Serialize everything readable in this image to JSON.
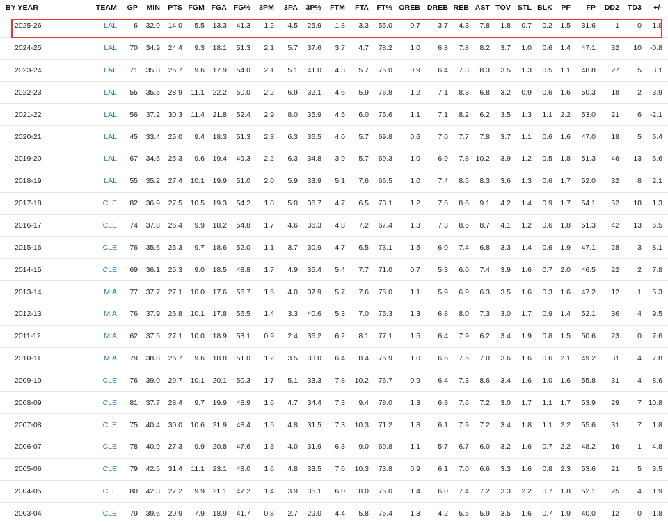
{
  "table": {
    "columns": [
      "BY YEAR",
      "TEAM",
      "GP",
      "MIN",
      "PTS",
      "FGM",
      "FGA",
      "FG%",
      "3PM",
      "3PA",
      "3P%",
      "FTM",
      "FTA",
      "FT%",
      "OREB",
      "DREB",
      "REB",
      "AST",
      "TOV",
      "STL",
      "BLK",
      "PF",
      "FP",
      "DD2",
      "TD3",
      "+/-"
    ],
    "highlighted_row": 0,
    "highlight_color": "#e53935",
    "team_link_color": "#1d72c2",
    "rows": [
      [
        "2025-26",
        "LAL",
        "6",
        "32.9",
        "14.0",
        "5.5",
        "13.3",
        "41.3",
        "1.2",
        "4.5",
        "25.9",
        "1.8",
        "3.3",
        "55.0",
        "0.7",
        "3.7",
        "4.3",
        "7.8",
        "1.8",
        "0.7",
        "0.2",
        "1.5",
        "31.6",
        "1",
        "0",
        "1.8"
      ],
      [
        "2024-25",
        "LAL",
        "70",
        "34.9",
        "24.4",
        "9.3",
        "18.1",
        "51.3",
        "2.1",
        "5.7",
        "37.6",
        "3.7",
        "4.7",
        "78.2",
        "1.0",
        "6.8",
        "7.8",
        "8.2",
        "3.7",
        "1.0",
        "0.6",
        "1.4",
        "47.1",
        "32",
        "10",
        "-0.8"
      ],
      [
        "2023-24",
        "LAL",
        "71",
        "35.3",
        "25.7",
        "9.6",
        "17.9",
        "54.0",
        "2.1",
        "5.1",
        "41.0",
        "4.3",
        "5.7",
        "75.0",
        "0.9",
        "6.4",
        "7.3",
        "8.3",
        "3.5",
        "1.3",
        "0.5",
        "1.1",
        "48.8",
        "27",
        "5",
        "3.1"
      ],
      [
        "2022-23",
        "LAL",
        "55",
        "35.5",
        "28.9",
        "11.1",
        "22.2",
        "50.0",
        "2.2",
        "6.9",
        "32.1",
        "4.6",
        "5.9",
        "76.8",
        "1.2",
        "7.1",
        "8.3",
        "6.8",
        "3.2",
        "0.9",
        "0.6",
        "1.6",
        "50.3",
        "18",
        "2",
        "3.9"
      ],
      [
        "2021-22",
        "LAL",
        "56",
        "37.2",
        "30.3",
        "11.4",
        "21.8",
        "52.4",
        "2.9",
        "8.0",
        "35.9",
        "4.5",
        "6.0",
        "75.6",
        "1.1",
        "7.1",
        "8.2",
        "6.2",
        "3.5",
        "1.3",
        "1.1",
        "2.2",
        "53.0",
        "21",
        "6",
        "-2.1"
      ],
      [
        "2020-21",
        "LAL",
        "45",
        "33.4",
        "25.0",
        "9.4",
        "18.3",
        "51.3",
        "2.3",
        "6.3",
        "36.5",
        "4.0",
        "5.7",
        "69.8",
        "0.6",
        "7.0",
        "7.7",
        "7.8",
        "3.7",
        "1.1",
        "0.6",
        "1.6",
        "47.0",
        "18",
        "5",
        "6.4"
      ],
      [
        "2019-20",
        "LAL",
        "67",
        "34.6",
        "25.3",
        "9.6",
        "19.4",
        "49.3",
        "2.2",
        "6.3",
        "34.8",
        "3.9",
        "5.7",
        "69.3",
        "1.0",
        "6.9",
        "7.8",
        "10.2",
        "3.9",
        "1.2",
        "0.5",
        "1.8",
        "51.3",
        "46",
        "13",
        "6.6"
      ],
      [
        "2018-19",
        "LAL",
        "55",
        "35.2",
        "27.4",
        "10.1",
        "19.9",
        "51.0",
        "2.0",
        "5.9",
        "33.9",
        "5.1",
        "7.6",
        "66.5",
        "1.0",
        "7.4",
        "8.5",
        "8.3",
        "3.6",
        "1.3",
        "0.6",
        "1.7",
        "52.0",
        "32",
        "8",
        "2.1"
      ],
      [
        "2017-18",
        "CLE",
        "82",
        "36.9",
        "27.5",
        "10.5",
        "19.3",
        "54.2",
        "1.8",
        "5.0",
        "36.7",
        "4.7",
        "6.5",
        "73.1",
        "1.2",
        "7.5",
        "8.6",
        "9.1",
        "4.2",
        "1.4",
        "0.9",
        "1.7",
        "54.1",
        "52",
        "18",
        "1.3"
      ],
      [
        "2016-17",
        "CLE",
        "74",
        "37.8",
        "26.4",
        "9.9",
        "18.2",
        "54.8",
        "1.7",
        "4.6",
        "36.3",
        "4.8",
        "7.2",
        "67.4",
        "1.3",
        "7.3",
        "8.6",
        "8.7",
        "4.1",
        "1.2",
        "0.6",
        "1.8",
        "51.3",
        "42",
        "13",
        "6.5"
      ],
      [
        "2015-16",
        "CLE",
        "76",
        "35.6",
        "25.3",
        "9.7",
        "18.6",
        "52.0",
        "1.1",
        "3.7",
        "30.9",
        "4.7",
        "6.5",
        "73.1",
        "1.5",
        "6.0",
        "7.4",
        "6.8",
        "3.3",
        "1.4",
        "0.6",
        "1.9",
        "47.1",
        "28",
        "3",
        "8.1"
      ],
      [
        "2014-15",
        "CLE",
        "69",
        "36.1",
        "25.3",
        "9.0",
        "18.5",
        "48.8",
        "1.7",
        "4.9",
        "35.4",
        "5.4",
        "7.7",
        "71.0",
        "0.7",
        "5.3",
        "6.0",
        "7.4",
        "3.9",
        "1.6",
        "0.7",
        "2.0",
        "46.5",
        "22",
        "2",
        "7.8"
      ],
      [
        "2013-14",
        "MIA",
        "77",
        "37.7",
        "27.1",
        "10.0",
        "17.6",
        "56.7",
        "1.5",
        "4.0",
        "37.9",
        "5.7",
        "7.6",
        "75.0",
        "1.1",
        "5.9",
        "6.9",
        "6.3",
        "3.5",
        "1.6",
        "0.3",
        "1.6",
        "47.2",
        "12",
        "1",
        "5.3"
      ],
      [
        "2012-13",
        "MIA",
        "76",
        "37.9",
        "26.8",
        "10.1",
        "17.8",
        "56.5",
        "1.4",
        "3.3",
        "40.6",
        "5.3",
        "7.0",
        "75.3",
        "1.3",
        "6.8",
        "8.0",
        "7.3",
        "3.0",
        "1.7",
        "0.9",
        "1.4",
        "52.1",
        "36",
        "4",
        "9.5"
      ],
      [
        "2011-12",
        "MIA",
        "62",
        "37.5",
        "27.1",
        "10.0",
        "18.9",
        "53.1",
        "0.9",
        "2.4",
        "36.2",
        "6.2",
        "8.1",
        "77.1",
        "1.5",
        "6.4",
        "7.9",
        "6.2",
        "3.4",
        "1.9",
        "0.8",
        "1.5",
        "50.6",
        "23",
        "0",
        "7.6"
      ],
      [
        "2010-11",
        "MIA",
        "79",
        "38.8",
        "26.7",
        "9.6",
        "18.8",
        "51.0",
        "1.2",
        "3.5",
        "33.0",
        "6.4",
        "8.4",
        "75.9",
        "1.0",
        "6.5",
        "7.5",
        "7.0",
        "3.6",
        "1.6",
        "0.6",
        "2.1",
        "49.2",
        "31",
        "4",
        "7.8"
      ],
      [
        "2009-10",
        "CLE",
        "76",
        "39.0",
        "29.7",
        "10.1",
        "20.1",
        "50.3",
        "1.7",
        "5.1",
        "33.3",
        "7.8",
        "10.2",
        "76.7",
        "0.9",
        "6.4",
        "7.3",
        "8.6",
        "3.4",
        "1.6",
        "1.0",
        "1.6",
        "55.8",
        "31",
        "4",
        "8.6"
      ],
      [
        "2008-09",
        "CLE",
        "81",
        "37.7",
        "28.4",
        "9.7",
        "19.9",
        "48.9",
        "1.6",
        "4.7",
        "34.4",
        "7.3",
        "9.4",
        "78.0",
        "1.3",
        "6.3",
        "7.6",
        "7.2",
        "3.0",
        "1.7",
        "1.1",
        "1.7",
        "53.9",
        "29",
        "7",
        "10.8"
      ],
      [
        "2007-08",
        "CLE",
        "75",
        "40.4",
        "30.0",
        "10.6",
        "21.9",
        "48.4",
        "1.5",
        "4.8",
        "31.5",
        "7.3",
        "10.3",
        "71.2",
        "1.8",
        "6.1",
        "7.9",
        "7.2",
        "3.4",
        "1.8",
        "1.1",
        "2.2",
        "55.6",
        "31",
        "7",
        "1.8"
      ],
      [
        "2006-07",
        "CLE",
        "78",
        "40.9",
        "27.3",
        "9.9",
        "20.8",
        "47.6",
        "1.3",
        "4.0",
        "31.9",
        "6.3",
        "9.0",
        "69.8",
        "1.1",
        "5.7",
        "6.7",
        "6.0",
        "3.2",
        "1.6",
        "0.7",
        "2.2",
        "48.2",
        "16",
        "1",
        "4.8"
      ],
      [
        "2005-06",
        "CLE",
        "79",
        "42.5",
        "31.4",
        "11.1",
        "23.1",
        "48.0",
        "1.6",
        "4.8",
        "33.5",
        "7.6",
        "10.3",
        "73.8",
        "0.9",
        "6.1",
        "7.0",
        "6.6",
        "3.3",
        "1.6",
        "0.8",
        "2.3",
        "53.6",
        "21",
        "5",
        "3.5"
      ],
      [
        "2004-05",
        "CLE",
        "80",
        "42.3",
        "27.2",
        "9.9",
        "21.1",
        "47.2",
        "1.4",
        "3.9",
        "35.1",
        "6.0",
        "8.0",
        "75.0",
        "1.4",
        "6.0",
        "7.4",
        "7.2",
        "3.3",
        "2.2",
        "0.7",
        "1.8",
        "52.1",
        "25",
        "4",
        "1.9"
      ],
      [
        "2003-04",
        "CLE",
        "79",
        "39.6",
        "20.9",
        "7.9",
        "18.9",
        "41.7",
        "0.8",
        "2.7",
        "29.0",
        "4.4",
        "5.8",
        "75.4",
        "1.3",
        "4.2",
        "5.5",
        "5.9",
        "3.5",
        "1.6",
        "0.7",
        "1.9",
        "40.0",
        "12",
        "0",
        "-1.8"
      ]
    ]
  }
}
